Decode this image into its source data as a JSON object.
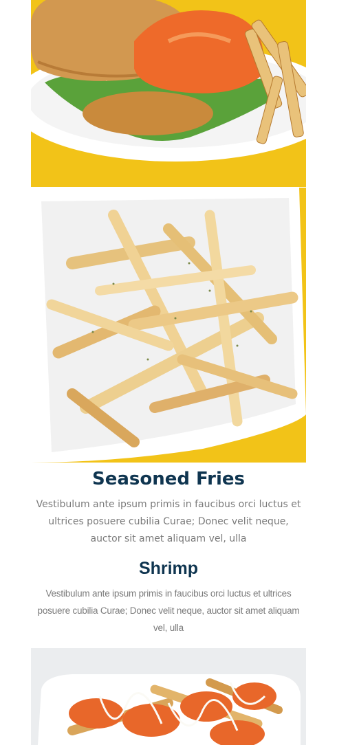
{
  "images": {
    "burger": "burger-with-fries-photo",
    "fries": "seasoned-fries-photo",
    "shrimp": "shrimp-fries-photo"
  },
  "menu": {
    "items": [
      {
        "title": "Seasoned Fries",
        "description": "Vestibulum ante ipsum primis in faucibus orci luctus et ultrices posuere cubilia Curae; Donec velit neque, auctor sit amet aliquam vel, ulla"
      },
      {
        "title": "Shrimp",
        "description": "Vestibulum ante ipsum primis in faucibus orci luctus et ultrices posuere cubilia Curae; Donec velit neque, auctor sit amet aliquam vel, ulla"
      }
    ]
  },
  "colors": {
    "title": "#0f3550",
    "body_text": "#7a7a7a",
    "placemat_yellow": "#f2c318"
  }
}
